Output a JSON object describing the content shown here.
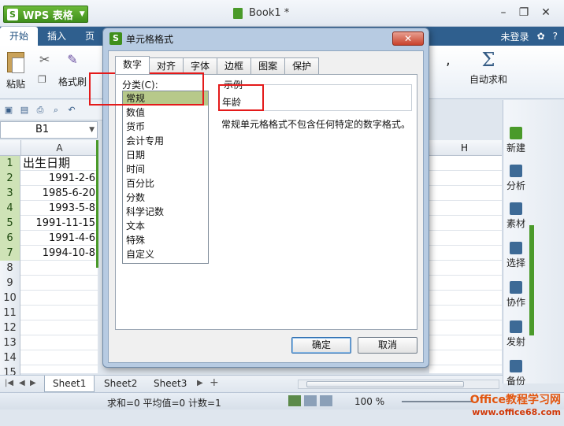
{
  "app": {
    "name": "WPS 表格",
    "logo": "S",
    "doc_title": "Book1 *"
  },
  "window": {
    "min": "–",
    "restore": "❐",
    "close": "✕"
  },
  "ribbon_tabs": [
    "开始",
    "插入",
    "页"
  ],
  "topright": {
    "login": "未登录",
    "help": "?"
  },
  "ribbon": {
    "paste": "粘贴",
    "format_painter": "格式刷",
    "autosum": "自动求和",
    "comma": ","
  },
  "namebox": {
    "value": "B1"
  },
  "grid": {
    "col_a": "A",
    "col_h": "H",
    "rows": [
      {
        "n": "1",
        "v": "出生日期"
      },
      {
        "n": "2",
        "v": "1991-2-6"
      },
      {
        "n": "3",
        "v": "1985-6-20"
      },
      {
        "n": "4",
        "v": "1993-5-8"
      },
      {
        "n": "5",
        "v": "1991-11-15"
      },
      {
        "n": "6",
        "v": "1991-4-6"
      },
      {
        "n": "7",
        "v": "1994-10-8"
      },
      {
        "n": "8",
        "v": ""
      },
      {
        "n": "9",
        "v": ""
      },
      {
        "n": "10",
        "v": ""
      },
      {
        "n": "11",
        "v": ""
      },
      {
        "n": "12",
        "v": ""
      },
      {
        "n": "13",
        "v": ""
      },
      {
        "n": "14",
        "v": ""
      },
      {
        "n": "15",
        "v": ""
      }
    ]
  },
  "taskpane": [
    "新建",
    "分析",
    "素材",
    "选择",
    "协作",
    "发射",
    "备份"
  ],
  "sheets": {
    "tabs": [
      "Sheet1",
      "Sheet2",
      "Sheet3"
    ],
    "add": "+"
  },
  "status": {
    "stats": "求和=0  平均值=0  计数=1",
    "zoom": "100 %"
  },
  "watermark": {
    "brand": "Office教程学习网",
    "url": "www.office68.com"
  },
  "dialog": {
    "title": "单元格格式",
    "close": "✕",
    "tabs": [
      "数字",
      "对齐",
      "字体",
      "边框",
      "图案",
      "保护"
    ],
    "category_label": "分类(C):",
    "categories": [
      "常规",
      "数值",
      "货币",
      "会计专用",
      "日期",
      "时间",
      "百分比",
      "分数",
      "科学记数",
      "文本",
      "特殊",
      "自定义"
    ],
    "sample_label": "示例",
    "sample_value": "年龄",
    "description": "常规单元格格式不包含任何特定的数字格式。",
    "ok": "确定",
    "cancel": "取消"
  },
  "colors": {
    "accent_green": "#4a9a2a",
    "tab_blue": "#2f5f8e",
    "highlight_red": "#e41a1a"
  }
}
